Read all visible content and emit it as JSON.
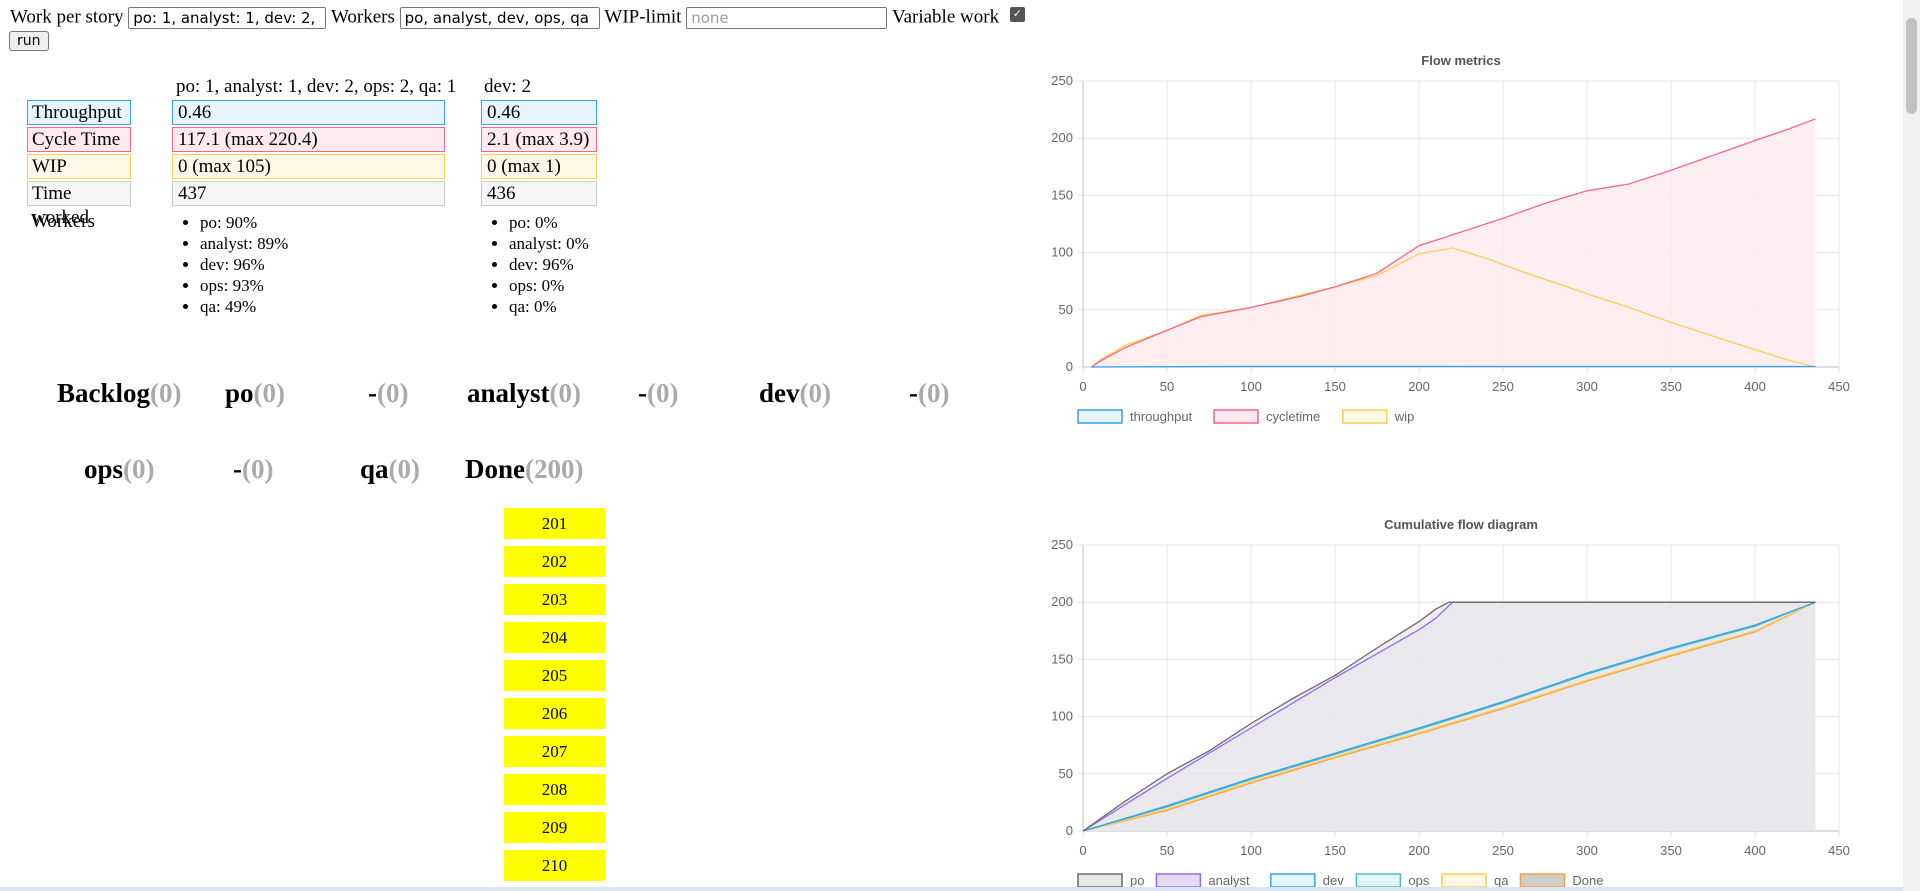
{
  "controls": {
    "work_label": "Work per story",
    "work_value": "po: 1, analyst: 1, dev: 2, ops: 2, qa: 1",
    "workers_label": "Workers",
    "workers_value": "po, analyst, dev, ops, qa",
    "wip_label": "WIP-limit",
    "wip_placeholder": "none",
    "variable_label": "Variable work",
    "variable_checked": true,
    "run_label": "run"
  },
  "stats": {
    "labels": {
      "throughput": "Throughput",
      "cycletime": "Cycle Time",
      "wip": "WIP",
      "time": "Time worked",
      "workers": "Workers"
    },
    "scenarios": [
      {
        "header": "po: 1, analyst: 1, dev: 2, ops: 2, qa: 1",
        "throughput": "0.46",
        "cycletime": "117.1 (max 220.4)",
        "wip": "0 (max 105)",
        "time": "437",
        "workers": [
          "po: 90%",
          "analyst: 89%",
          "dev: 96%",
          "ops: 93%",
          "qa: 49%"
        ]
      },
      {
        "header": "dev: 2",
        "throughput": "0.46",
        "cycletime": "2.1 (max 3.9)",
        "wip": "0 (max 1)",
        "time": "436",
        "workers": [
          "po: 0%",
          "analyst: 0%",
          "dev: 96%",
          "ops: 0%",
          "qa: 0%"
        ]
      }
    ]
  },
  "board": {
    "columns": [
      {
        "name": "Backlog",
        "count": "(0)"
      },
      {
        "name": "po",
        "count": "(0)"
      },
      {
        "name": "-",
        "count": "(0)"
      },
      {
        "name": "analyst",
        "count": "(0)"
      },
      {
        "name": "-",
        "count": "(0)"
      },
      {
        "name": "dev",
        "count": "(0)"
      },
      {
        "name": "-",
        "count": "(0)"
      },
      {
        "name": "ops",
        "count": "(0)"
      },
      {
        "name": "-",
        "count": "(0)"
      },
      {
        "name": "qa",
        "count": "(0)"
      },
      {
        "name": "Done",
        "count": "(200)"
      }
    ],
    "done_cards": [
      "201",
      "202",
      "203",
      "204",
      "205",
      "206",
      "207",
      "208",
      "209",
      "210"
    ],
    "card_color": "#ffff00"
  },
  "chart_data": [
    {
      "type": "area",
      "title": "Flow metrics",
      "xlabel": "",
      "ylabel": "",
      "xlim": [
        0,
        450
      ],
      "ylim": [
        0,
        250
      ],
      "xticks": [
        "0",
        "50",
        "100",
        "150",
        "200",
        "250",
        "300",
        "350",
        "400",
        "450"
      ],
      "yticks": [
        "0",
        "50",
        "100",
        "150",
        "200",
        "250"
      ],
      "grid": true,
      "legend": "bottom-left",
      "series": [
        {
          "name": "throughput",
          "color": "#36a2eb",
          "fill": "#e6f4fd",
          "x": [
            5,
            100,
            200,
            300,
            436
          ],
          "y": [
            0,
            0.5,
            0.5,
            0.46,
            0.46
          ]
        },
        {
          "name": "cycletime",
          "color": "#ff6384",
          "fill": "#ffeaef",
          "x": [
            5,
            10,
            25,
            50,
            70,
            100,
            130,
            150,
            175,
            200,
            225,
            250,
            275,
            300,
            325,
            350,
            375,
            400,
            420,
            436
          ],
          "y": [
            0,
            5,
            17,
            32,
            44,
            52,
            62,
            70,
            82,
            106,
            118,
            130,
            143,
            154,
            160,
            172,
            185,
            198,
            208,
            217
          ]
        },
        {
          "name": "wip",
          "color": "#ffce56",
          "fill": "#fff8e7",
          "x": [
            5,
            10,
            25,
            50,
            70,
            100,
            130,
            150,
            175,
            200,
            220,
            240,
            260,
            280,
            300,
            325,
            350,
            375,
            400,
            420,
            436
          ],
          "y": [
            0,
            6,
            19,
            32,
            45,
            52,
            63,
            70,
            80,
            99,
            104,
            95,
            84,
            74,
            64,
            52,
            39,
            27,
            15,
            6,
            0
          ]
        }
      ]
    },
    {
      "type": "area",
      "title": "Cumulative flow diagram",
      "xlabel": "",
      "ylabel": "",
      "xlim": [
        0,
        450
      ],
      "ylim": [
        0,
        250
      ],
      "xticks": [
        "0",
        "50",
        "100",
        "150",
        "200",
        "250",
        "300",
        "350",
        "400",
        "450"
      ],
      "yticks": [
        "0",
        "50",
        "100",
        "150",
        "200",
        "250"
      ],
      "grid": true,
      "legend": "bottom-left",
      "series": [
        {
          "name": "po",
          "color": "#6b6b6b",
          "fill": "#e8e8e8",
          "x": [
            0,
            25,
            50,
            75,
            100,
            125,
            150,
            175,
            200,
            210,
            218,
            436
          ],
          "y": [
            0,
            26,
            50,
            70,
            94,
            116,
            136,
            160,
            183,
            194,
            200,
            200
          ]
        },
        {
          "name": "analyst",
          "color": "#9966ff",
          "fill": "#e3dcf3",
          "x": [
            0,
            25,
            50,
            75,
            100,
            125,
            150,
            175,
            200,
            210,
            220,
            436
          ],
          "y": [
            0,
            23,
            46,
            68,
            90,
            112,
            134,
            155,
            176,
            186,
            200,
            200
          ]
        },
        {
          "name": "dev",
          "color": "#36a2eb",
          "fill": "#e6f4fd",
          "x": [
            0,
            50,
            100,
            150,
            200,
            250,
            300,
            350,
            400,
            436
          ],
          "y": [
            0,
            22,
            46,
            68,
            90,
            113,
            138,
            160,
            180,
            200
          ]
        },
        {
          "name": "ops",
          "color": "#4bc0c0",
          "fill": "#e4f5f5",
          "x": [
            0,
            50,
            100,
            150,
            200,
            250,
            300,
            350,
            400,
            436
          ],
          "y": [
            0,
            21,
            45,
            67,
            89,
            112,
            137,
            159,
            179,
            200
          ]
        },
        {
          "name": "qa",
          "color": "#ffce56",
          "fill": "#fff8e7",
          "x": [
            0,
            50,
            100,
            150,
            200,
            250,
            300,
            350,
            400,
            436
          ],
          "y": [
            0,
            19,
            43,
            65,
            86,
            108,
            132,
            154,
            175,
            200
          ]
        },
        {
          "name": "Done",
          "color": "#ff9f40",
          "fill": "#cfcec8",
          "x": [
            0,
            50,
            100,
            150,
            200,
            250,
            300,
            350,
            400,
            436
          ],
          "y": [
            0,
            18,
            42,
            64,
            85,
            107,
            131,
            153,
            174,
            200
          ]
        }
      ]
    }
  ]
}
